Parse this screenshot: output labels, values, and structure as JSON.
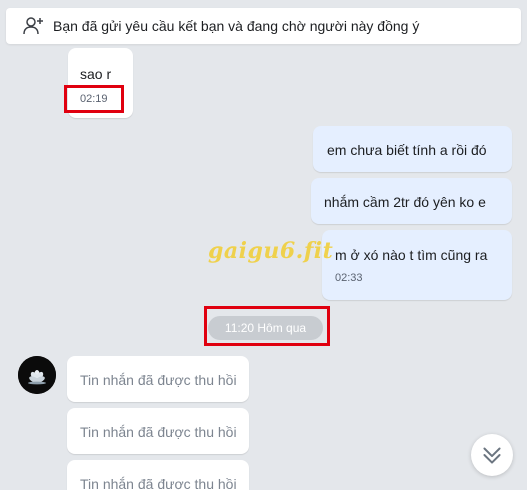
{
  "notice": {
    "icon": "add-friend-icon",
    "text": "Bạn đã gửi yêu cầu kết bạn và đang chờ người này đồng ý"
  },
  "messages": [
    {
      "direction": "incoming",
      "text": "sao r",
      "time": "02:19"
    },
    {
      "direction": "outgoing",
      "text": "em chưa biết tính a rồi đó"
    },
    {
      "direction": "outgoing",
      "text": "nhắm cầm 2tr đó yên ko e"
    },
    {
      "direction": "outgoing",
      "text": "m ở xó nào t tìm cũng ra",
      "time": "02:33"
    }
  ],
  "date_divider": "11:20 Hôm qua",
  "avatar_icon": "lotus-avatar-icon",
  "recalled_messages": [
    {
      "text": "Tin nhắn đã được thu hồi"
    },
    {
      "text": "Tin nhắn đã được thu hồi"
    },
    {
      "text": "Tin nhắn đã được thu hồi"
    }
  ],
  "watermark": "gaigu6.fit",
  "scroll_button_icon": "double-chevron-down-icon",
  "colors": {
    "background": "#e4e7eb",
    "outgoing_bubble": "#e5efff",
    "incoming_bubble": "#ffffff",
    "highlight": "#e0000f",
    "watermark": "#f2ce31"
  }
}
